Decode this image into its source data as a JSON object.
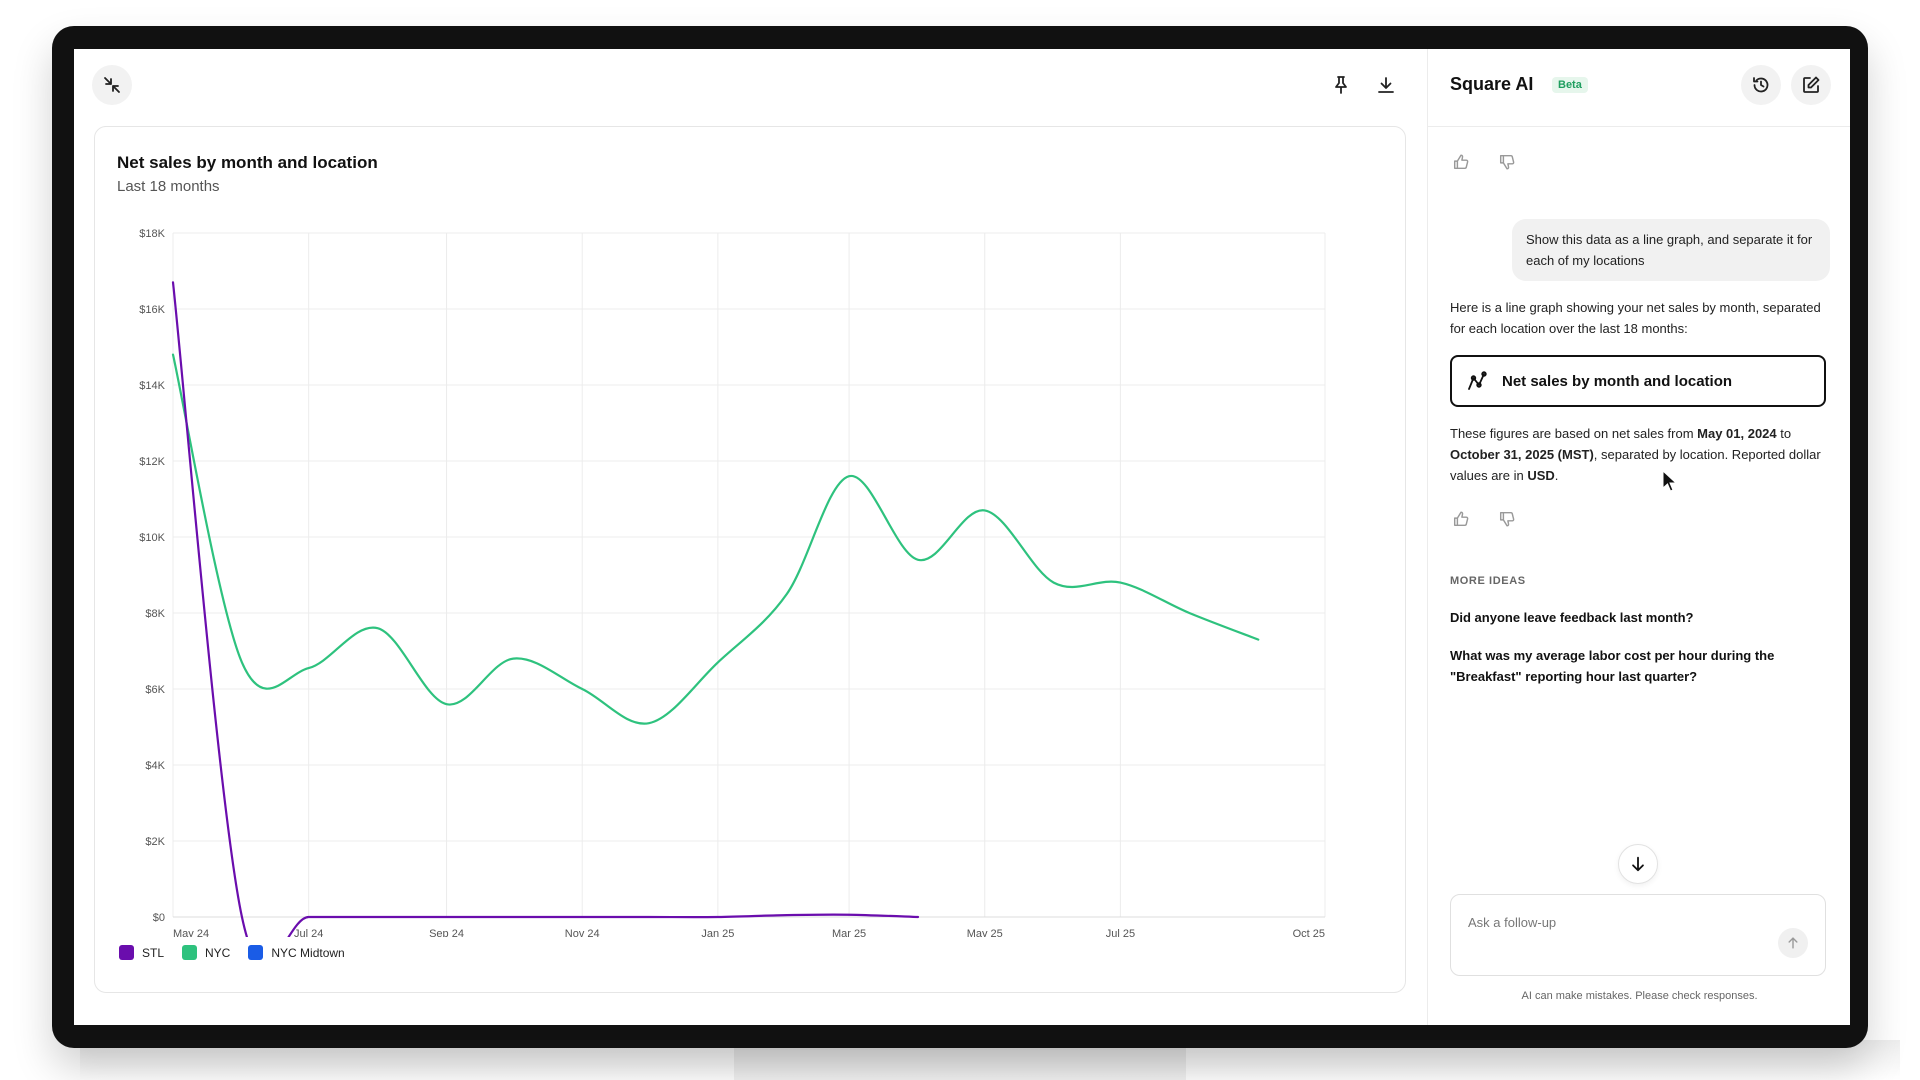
{
  "colors": {
    "stl": "#6a0dad",
    "nyc": "#2ec27e",
    "nyc_midtown": "#1a5ce6",
    "beta": "#1f9e5f"
  },
  "toolbar": {
    "collapse_icon": "collapse-arrows-icon",
    "pin_icon": "pin-icon",
    "download_icon": "download-icon"
  },
  "chart_card": {
    "title": "Net sales by month and location",
    "subtitle": "Last 18 months"
  },
  "chart_data": {
    "type": "line",
    "title": "Net sales by month and location",
    "subtitle": "Last 18 months",
    "xlabel": "",
    "ylabel": "",
    "x_ticks": [
      "May 24",
      "Jul 24",
      "Sep 24",
      "Nov 24",
      "Jan 25",
      "Mar 25",
      "May 25",
      "Jul 25",
      "Oct 25"
    ],
    "y_ticks": [
      "$18K",
      "$16K",
      "$14K",
      "$12K",
      "$10K",
      "$8K",
      "$6K",
      "$4K",
      "$2K",
      "$0"
    ],
    "ylim": [
      0,
      18000
    ],
    "xlim": [
      "2024-05-01",
      "2025-10-01"
    ],
    "grid": true,
    "legend_position": "bottom-left",
    "series": [
      {
        "name": "STL",
        "color": "#6a0dad",
        "points": [
          {
            "x": "2024-05-01",
            "y": 16700
          },
          {
            "x": "2024-06-01",
            "y": 0
          },
          {
            "x": "2024-07-01",
            "y": 0
          },
          {
            "x": "2024-08-01",
            "y": 0
          },
          {
            "x": "2024-09-01",
            "y": 0
          },
          {
            "x": "2024-10-01",
            "y": 0
          },
          {
            "x": "2024-11-01",
            "y": 0
          },
          {
            "x": "2024-12-01",
            "y": 0
          },
          {
            "x": "2025-01-01",
            "y": 0
          },
          {
            "x": "2025-02-01",
            "y": 50
          },
          {
            "x": "2025-03-01",
            "y": 60
          },
          {
            "x": "2025-04-01",
            "y": 0
          }
        ]
      },
      {
        "name": "NYC",
        "color": "#2ec27e",
        "points": [
          {
            "x": "2024-05-01",
            "y": 14800
          },
          {
            "x": "2024-06-01",
            "y": 6700
          },
          {
            "x": "2024-07-01",
            "y": 6550
          },
          {
            "x": "2024-08-01",
            "y": 7600
          },
          {
            "x": "2024-09-01",
            "y": 5600
          },
          {
            "x": "2024-10-01",
            "y": 6800
          },
          {
            "x": "2024-11-01",
            "y": 6000
          },
          {
            "x": "2024-12-01",
            "y": 5100
          },
          {
            "x": "2025-01-01",
            "y": 6700
          },
          {
            "x": "2025-02-01",
            "y": 8500
          },
          {
            "x": "2025-03-01",
            "y": 11600
          },
          {
            "x": "2025-04-01",
            "y": 9400
          },
          {
            "x": "2025-05-01",
            "y": 10700
          },
          {
            "x": "2025-06-01",
            "y": 8800
          },
          {
            "x": "2025-07-01",
            "y": 8800
          },
          {
            "x": "2025-08-01",
            "y": 8000
          },
          {
            "x": "2025-09-01",
            "y": 7300
          }
        ]
      },
      {
        "name": "NYC Midtown",
        "color": "#1a5ce6",
        "points": []
      }
    ]
  },
  "panel": {
    "title": "Square AI",
    "badge": "Beta",
    "history_icon": "history-icon",
    "compose_icon": "compose-icon",
    "user_message": "Show this data as a line graph, and separate it for each of my locations",
    "ai_intro": "Here is a line graph showing your net sales by month, separated for each location over the last 18 months:",
    "chart_link_label": "Net sales by month and location",
    "ai_note": {
      "p1": "These figures are based on net sales from ",
      "date_start": "May 01, 2024",
      "p2": " to ",
      "date_end": "October 31, 2025 (MST)",
      "p3": ", separated by location. Reported dollar values are in ",
      "currency": "USD",
      "p4": "."
    },
    "more_ideas_heading": "MORE IDEAS",
    "ideas": [
      "Did anyone leave feedback last month?",
      "What was my average labor cost per hour during the \"Breakfast\" reporting hour last quarter?"
    ],
    "followup_placeholder": "Ask a follow-up",
    "disclaimer": "AI can make mistakes. Please check responses."
  }
}
